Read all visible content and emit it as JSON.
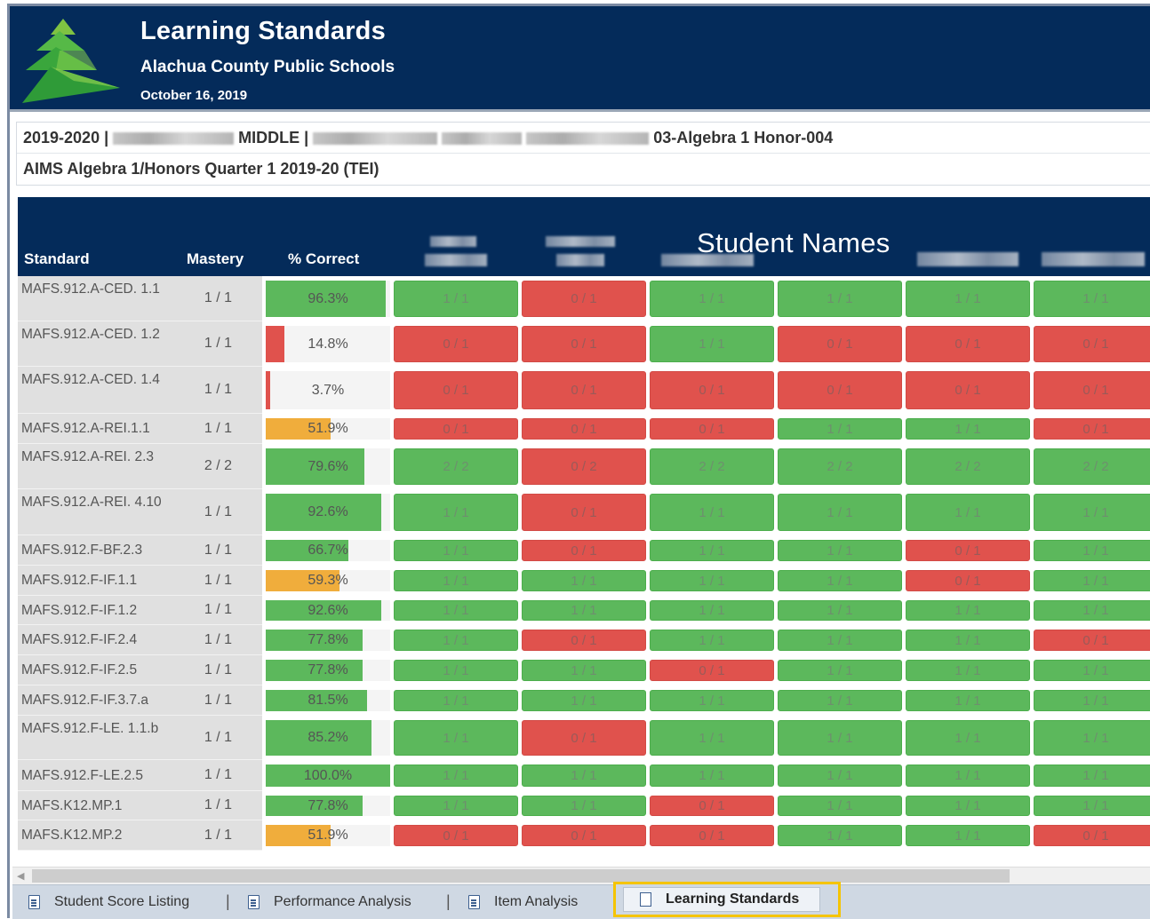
{
  "header": {
    "title": "Learning Standards",
    "district": "Alachua County Public Schools",
    "date": "October 16, 2019"
  },
  "info": {
    "line1_prefix": "2019-2020 |",
    "line1_middle": "MIDDLE |",
    "line1_suffix": "03-Algebra 1 Honor-004",
    "line2": "AIMS Algebra 1/Honors Quarter 1 2019-20 (TEI)"
  },
  "table": {
    "col_standard": "Standard",
    "col_mastery": "Mastery",
    "col_correct": "% Correct",
    "students_label": "Student Names",
    "rows": [
      {
        "standard": "MAFS.912.A-CED. 1.1",
        "mastery": "1 / 1",
        "pct_label": "96.3%",
        "pct": 96.3,
        "pct_color": "green",
        "cells": [
          [
            "1 / 1",
            "g"
          ],
          [
            "0 / 1",
            "r"
          ],
          [
            "1 / 1",
            "g"
          ],
          [
            "1 / 1",
            "g"
          ],
          [
            "1 / 1",
            "g"
          ],
          [
            "1 / 1",
            "g"
          ]
        ]
      },
      {
        "standard": "MAFS.912.A-CED. 1.2",
        "mastery": "1 / 1",
        "pct_label": "14.8%",
        "pct": 14.8,
        "pct_color": "red",
        "cells": [
          [
            "0 / 1",
            "r"
          ],
          [
            "0 / 1",
            "r"
          ],
          [
            "1 / 1",
            "g"
          ],
          [
            "0 / 1",
            "r"
          ],
          [
            "0 / 1",
            "r"
          ],
          [
            "0 / 1",
            "r"
          ]
        ]
      },
      {
        "standard": "MAFS.912.A-CED. 1.4",
        "mastery": "1 / 1",
        "pct_label": "3.7%",
        "pct": 3.7,
        "pct_color": "red",
        "cells": [
          [
            "0 / 1",
            "r"
          ],
          [
            "0 / 1",
            "r"
          ],
          [
            "0 / 1",
            "r"
          ],
          [
            "0 / 1",
            "r"
          ],
          [
            "0 / 1",
            "r"
          ],
          [
            "0 / 1",
            "r"
          ]
        ]
      },
      {
        "standard": "MAFS.912.A-REI.1.1",
        "mastery": "1 / 1",
        "pct_label": "51.9%",
        "pct": 51.9,
        "pct_color": "orange",
        "cells": [
          [
            "0 / 1",
            "r"
          ],
          [
            "0 / 1",
            "r"
          ],
          [
            "0 / 1",
            "r"
          ],
          [
            "1 / 1",
            "g"
          ],
          [
            "1 / 1",
            "g"
          ],
          [
            "0 / 1",
            "r"
          ]
        ]
      },
      {
        "standard": "MAFS.912.A-REI. 2.3",
        "mastery": "2 / 2",
        "pct_label": "79.6%",
        "pct": 79.6,
        "pct_color": "green",
        "cells": [
          [
            "2 / 2",
            "g"
          ],
          [
            "0 / 2",
            "r"
          ],
          [
            "2 / 2",
            "g"
          ],
          [
            "2 / 2",
            "g"
          ],
          [
            "2 / 2",
            "g"
          ],
          [
            "2 / 2",
            "g"
          ]
        ]
      },
      {
        "standard": "MAFS.912.A-REI. 4.10",
        "mastery": "1 / 1",
        "pct_label": "92.6%",
        "pct": 92.6,
        "pct_color": "green",
        "cells": [
          [
            "1 / 1",
            "g"
          ],
          [
            "0 / 1",
            "r"
          ],
          [
            "1 / 1",
            "g"
          ],
          [
            "1 / 1",
            "g"
          ],
          [
            "1 / 1",
            "g"
          ],
          [
            "1 / 1",
            "g"
          ]
        ]
      },
      {
        "standard": "MAFS.912.F-BF.2.3",
        "mastery": "1 / 1",
        "pct_label": "66.7%",
        "pct": 66.7,
        "pct_color": "green",
        "cells": [
          [
            "1 / 1",
            "g"
          ],
          [
            "0 / 1",
            "r"
          ],
          [
            "1 / 1",
            "g"
          ],
          [
            "1 / 1",
            "g"
          ],
          [
            "0 / 1",
            "r"
          ],
          [
            "1 / 1",
            "g"
          ]
        ]
      },
      {
        "standard": "MAFS.912.F-IF.1.1",
        "mastery": "1 / 1",
        "pct_label": "59.3%",
        "pct": 59.3,
        "pct_color": "orange",
        "cells": [
          [
            "1 / 1",
            "g"
          ],
          [
            "1 / 1",
            "g"
          ],
          [
            "1 / 1",
            "g"
          ],
          [
            "1 / 1",
            "g"
          ],
          [
            "0 / 1",
            "r"
          ],
          [
            "1 / 1",
            "g"
          ]
        ]
      },
      {
        "standard": "MAFS.912.F-IF.1.2",
        "mastery": "1 / 1",
        "pct_label": "92.6%",
        "pct": 92.6,
        "pct_color": "green",
        "cells": [
          [
            "1 / 1",
            "g"
          ],
          [
            "1 / 1",
            "g"
          ],
          [
            "1 / 1",
            "g"
          ],
          [
            "1 / 1",
            "g"
          ],
          [
            "1 / 1",
            "g"
          ],
          [
            "1 / 1",
            "g"
          ]
        ]
      },
      {
        "standard": "MAFS.912.F-IF.2.4",
        "mastery": "1 / 1",
        "pct_label": "77.8%",
        "pct": 77.8,
        "pct_color": "green",
        "cells": [
          [
            "1 / 1",
            "g"
          ],
          [
            "0 / 1",
            "r"
          ],
          [
            "1 / 1",
            "g"
          ],
          [
            "1 / 1",
            "g"
          ],
          [
            "1 / 1",
            "g"
          ],
          [
            "0 / 1",
            "r"
          ]
        ]
      },
      {
        "standard": "MAFS.912.F-IF.2.5",
        "mastery": "1 / 1",
        "pct_label": "77.8%",
        "pct": 77.8,
        "pct_color": "green",
        "cells": [
          [
            "1 / 1",
            "g"
          ],
          [
            "1 / 1",
            "g"
          ],
          [
            "0 / 1",
            "r"
          ],
          [
            "1 / 1",
            "g"
          ],
          [
            "1 / 1",
            "g"
          ],
          [
            "1 / 1",
            "g"
          ]
        ]
      },
      {
        "standard": "MAFS.912.F-IF.3.7.a",
        "mastery": "1 / 1",
        "pct_label": "81.5%",
        "pct": 81.5,
        "pct_color": "green",
        "cells": [
          [
            "1 / 1",
            "g"
          ],
          [
            "1 / 1",
            "g"
          ],
          [
            "1 / 1",
            "g"
          ],
          [
            "1 / 1",
            "g"
          ],
          [
            "1 / 1",
            "g"
          ],
          [
            "1 / 1",
            "g"
          ]
        ]
      },
      {
        "standard": "MAFS.912.F-LE. 1.1.b",
        "mastery": "1 / 1",
        "pct_label": "85.2%",
        "pct": 85.2,
        "pct_color": "green",
        "cells": [
          [
            "1 / 1",
            "g"
          ],
          [
            "0 / 1",
            "r"
          ],
          [
            "1 / 1",
            "g"
          ],
          [
            "1 / 1",
            "g"
          ],
          [
            "1 / 1",
            "g"
          ],
          [
            "1 / 1",
            "g"
          ]
        ]
      },
      {
        "standard": "MAFS.912.F-LE.2.5",
        "mastery": "1 / 1",
        "pct_label": "100.0%",
        "pct": 100.0,
        "pct_color": "green",
        "cells": [
          [
            "1 / 1",
            "g"
          ],
          [
            "1 / 1",
            "g"
          ],
          [
            "1 / 1",
            "g"
          ],
          [
            "1 / 1",
            "g"
          ],
          [
            "1 / 1",
            "g"
          ],
          [
            "1 / 1",
            "g"
          ]
        ]
      },
      {
        "standard": "MAFS.K12.MP.1",
        "mastery": "1 / 1",
        "pct_label": "77.8%",
        "pct": 77.8,
        "pct_color": "green",
        "cells": [
          [
            "1 / 1",
            "g"
          ],
          [
            "1 / 1",
            "g"
          ],
          [
            "0 / 1",
            "r"
          ],
          [
            "1 / 1",
            "g"
          ],
          [
            "1 / 1",
            "g"
          ],
          [
            "1 / 1",
            "g"
          ]
        ]
      },
      {
        "standard": "MAFS.K12.MP.2",
        "mastery": "1 / 1",
        "pct_label": "51.9%",
        "pct": 51.9,
        "pct_color": "orange",
        "cells": [
          [
            "0 / 1",
            "r"
          ],
          [
            "0 / 1",
            "r"
          ],
          [
            "0 / 1",
            "r"
          ],
          [
            "1 / 1",
            "g"
          ],
          [
            "1 / 1",
            "g"
          ],
          [
            "0 / 1",
            "r"
          ]
        ]
      }
    ]
  },
  "colors": {
    "header_bg": "#042b5a",
    "green": "#5cb85c",
    "red": "#e0524d",
    "orange": "#f0ad3c",
    "tab_highlight": "#f5c400"
  },
  "tabs": [
    {
      "label": "Student Score Listing",
      "icon": "document-icon"
    },
    {
      "label": "Performance Analysis",
      "icon": "document-icon"
    },
    {
      "label": "Item Analysis",
      "icon": "document-icon"
    },
    {
      "label": "Learning Standards",
      "icon": "document-icon",
      "active": true
    }
  ]
}
